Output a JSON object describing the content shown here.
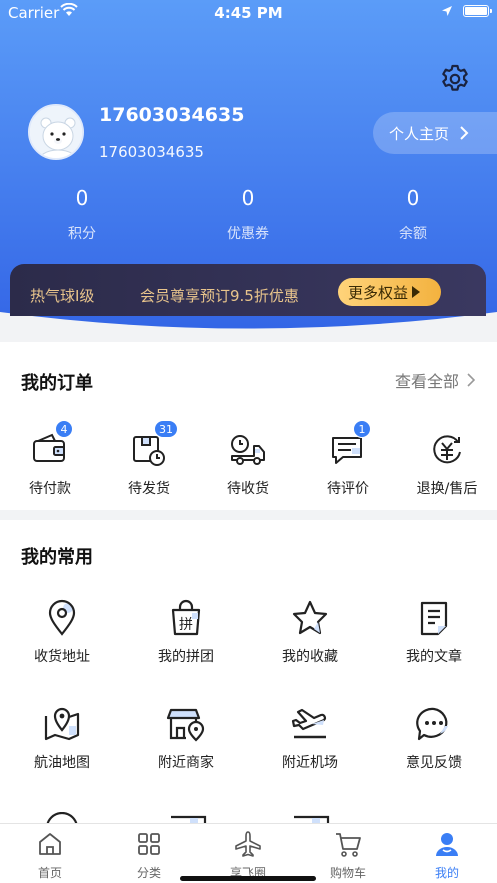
{
  "status_bar": {
    "carrier": "Carrier",
    "time": "4:45 PM"
  },
  "colors": {
    "accent": "#3a7ef5",
    "header_top": "#5b9cf8",
    "header_bottom": "#3466e6",
    "vip_gold": "#e8c48c"
  },
  "profile": {
    "username": "17603034635",
    "phone": "17603034635",
    "homepage_label": "个人主页"
  },
  "stats": [
    {
      "value": "0",
      "label": "积分"
    },
    {
      "value": "0",
      "label": "优惠券"
    },
    {
      "value": "0",
      "label": "余额"
    }
  ],
  "vip": {
    "level": "热气球I级",
    "desc": "会员尊享预订9.5折优惠",
    "button": "更多权益"
  },
  "orders": {
    "title": "我的订单",
    "see_all": "查看全部",
    "items": [
      {
        "label": "待付款",
        "icon": "wallet-icon",
        "badge": "4"
      },
      {
        "label": "待发货",
        "icon": "box-clock-icon",
        "badge": "31"
      },
      {
        "label": "待收货",
        "icon": "truck-icon",
        "badge": ""
      },
      {
        "label": "待评价",
        "icon": "comment-icon",
        "badge": "1"
      },
      {
        "label": "退换/售后",
        "icon": "refund-icon",
        "badge": ""
      }
    ]
  },
  "common": {
    "title": "我的常用",
    "items": [
      {
        "label": "收货地址",
        "icon": "location-pin-icon"
      },
      {
        "label": "我的拼团",
        "icon": "group-buy-bag-icon"
      },
      {
        "label": "我的收藏",
        "icon": "star-icon"
      },
      {
        "label": "我的文章",
        "icon": "article-icon"
      },
      {
        "label": "航油地图",
        "icon": "map-icon"
      },
      {
        "label": "附近商家",
        "icon": "shop-location-icon"
      },
      {
        "label": "附近机场",
        "icon": "plane-takeoff-icon"
      },
      {
        "label": "意见反馈",
        "icon": "feedback-chat-icon"
      }
    ],
    "bad_glyph": "拼"
  },
  "tabbar": [
    {
      "label": "首页",
      "icon": "home-icon",
      "active": false
    },
    {
      "label": "分类",
      "icon": "category-grid-icon",
      "active": false
    },
    {
      "label": "享飞圈",
      "icon": "airplane-icon",
      "active": false
    },
    {
      "label": "购物车",
      "icon": "cart-icon",
      "active": false
    },
    {
      "label": "我的",
      "icon": "user-icon",
      "active": true
    }
  ]
}
